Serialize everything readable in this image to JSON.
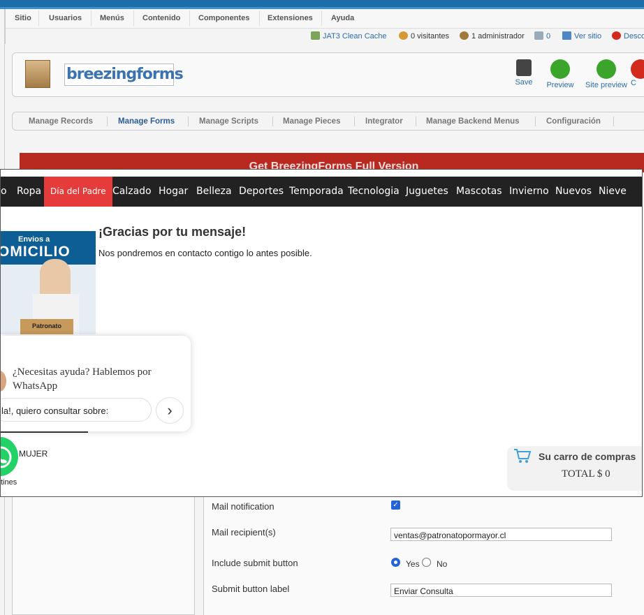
{
  "menu": [
    "Sitio",
    "Usuarios",
    "Menús",
    "Contenido",
    "Componentes",
    "Extensiones",
    "Ayuda"
  ],
  "status": {
    "cache": "JAT3 Clean Cache",
    "visitors": "0 visitantes",
    "admins": "1 administrador",
    "messages": "0",
    "view_site": "Ver sitio",
    "logout": "Desco"
  },
  "logo_text": "breezingforms",
  "toolbar": {
    "save": "Save",
    "preview": "Preview",
    "site_preview": "Site preview",
    "next": "C"
  },
  "subnav": [
    "Manage Records",
    "Manage Forms",
    "Manage Scripts",
    "Manage Pieces",
    "Integrator",
    "Manage Backend Menus",
    "Configuración"
  ],
  "promo_banner": "Get BreezingForms Full Version",
  "categories": [
    "o",
    "Ropa",
    "Día del Padre",
    "Calzado",
    "Hogar",
    "Belleza",
    "Deportes",
    "Temporada",
    "Tecnologia",
    "Juguetes",
    "Mascotas",
    "Invierno",
    "Nuevos",
    "Nieve"
  ],
  "promo_image": {
    "line1": "Envios a",
    "line2": "OMICILIO",
    "brand": "Patronato"
  },
  "thanks": {
    "title": "¡Gracias por tu mensaje!",
    "body": "Nos pondremos en contacto contigo lo antes posible."
  },
  "whatsapp": {
    "prompt": "¿Necesitas ayuda? Hablemos por WhatsApp",
    "input_value": "la!, quiero consultar sobre:"
  },
  "side_links": {
    "mujer": "MUJER",
    "tines": "tines"
  },
  "cart": {
    "title": "Su carro de compras",
    "total": "TOTAL $ 0"
  },
  "form": {
    "mail_notification_label": "Mail notification",
    "mail_notification_checked": true,
    "mail_recipient_label": "Mail recipient(s)",
    "mail_recipient_value": "ventas@patronatopormayor.cl",
    "include_submit_label": "Include submit button",
    "yes": "Yes",
    "no": "No",
    "submit_label_label": "Submit button label",
    "submit_label_value": "Enviar Consulta"
  },
  "colors": {
    "accent": "#2a6bb0",
    "banner": "#b82a1f",
    "highlight": "#e63b3b",
    "whatsapp": "#23d266"
  }
}
